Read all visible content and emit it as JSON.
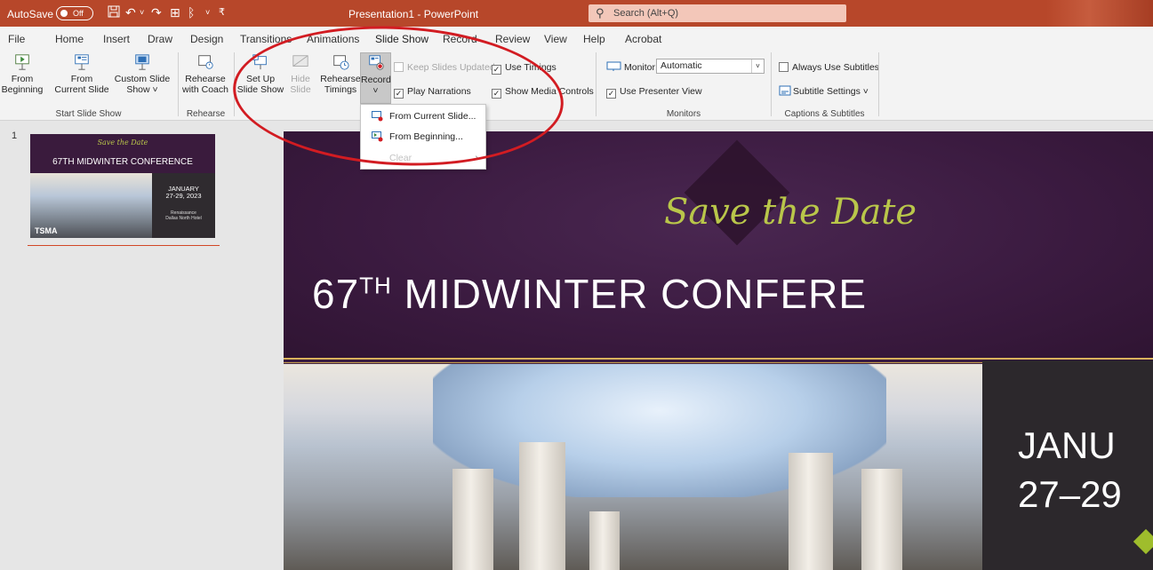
{
  "titlebar": {
    "autosave_label": "AutoSave",
    "autosave_state": "Off",
    "doc_title": "Presentation1 - PowerPoint",
    "search_placeholder": "Search (Alt+Q)",
    "colors": {
      "bar": "#b7472a",
      "search": "#f3c7b9"
    },
    "qat_icons": [
      "save-icon",
      "undo-icon",
      "redo-icon",
      "present-icon",
      "customize-icon",
      "more-icon"
    ]
  },
  "tabs": [
    "File",
    "Home",
    "Insert",
    "Draw",
    "Design",
    "Transitions",
    "Animations",
    "Slide Show",
    "Record",
    "Review",
    "View",
    "Help",
    "Acrobat"
  ],
  "active_tab": "Slide Show",
  "ribbon": {
    "start": {
      "from_beginning": [
        "From",
        "Beginning"
      ],
      "from_current": [
        "From",
        "Current Slide"
      ],
      "custom": [
        "Custom Slide",
        "Show ˅"
      ],
      "group": "Start Slide Show"
    },
    "rehearse": {
      "coach": [
        "Rehearse",
        "with Coach"
      ],
      "group": "Rehearse"
    },
    "setup": {
      "setup": [
        "Set Up",
        "Slide Show"
      ],
      "hide": [
        "Hide",
        "Slide"
      ],
      "timings": [
        "Rehearse",
        "Timings"
      ],
      "record": [
        "Record",
        "˅"
      ],
      "keep_updated": "Keep Slides Updated",
      "play_narrations": "Play Narrations",
      "use_timings": "Use Timings",
      "show_media": "Show Media Controls"
    },
    "monitors": {
      "monitor_label": "Monitor:",
      "monitor_value": "Automatic",
      "presenter_view": "Use Presenter View",
      "group": "Monitors"
    },
    "captions": {
      "always_subtitles": "Always Use Subtitles",
      "subtitle_settings": "Subtitle Settings ˅",
      "group": "Captions & Subtitles"
    }
  },
  "record_menu": {
    "items": [
      "From Current Slide...",
      "From Beginning...",
      "Clear"
    ]
  },
  "slides": {
    "number": "1",
    "thumb": {
      "save": "Save the Date",
      "conf": "67TH MIDWINTER CONFERENCE",
      "date1": "JANUARY",
      "date2": "27-29, 2023",
      "venue1": "Renaissance",
      "venue2": "Dallas North Hotel",
      "logo": "TSMA"
    }
  },
  "slide_main": {
    "save": "Save the Date",
    "conf_pre": "67",
    "conf_sup": "TH",
    "conf_post": " MIDWINTER CONFERE",
    "date1": "JANU",
    "date2": "27–29"
  }
}
